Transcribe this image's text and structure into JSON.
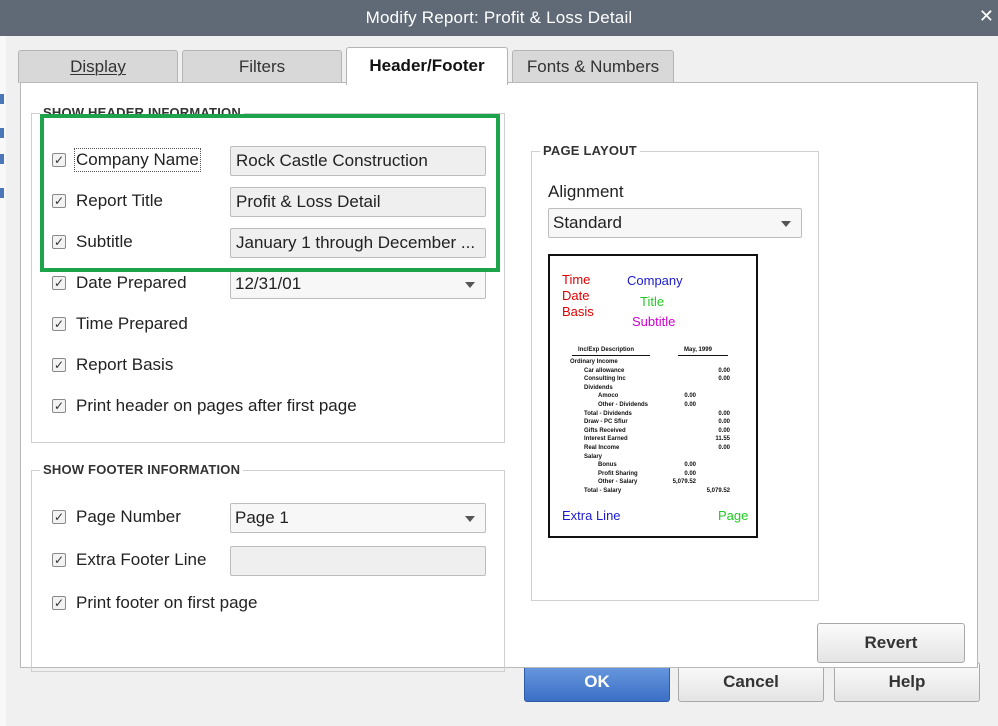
{
  "window": {
    "title": "Modify Report: Profit & Loss Detail",
    "close_glyph": "✕"
  },
  "tabs": [
    {
      "label": "Display",
      "active": false
    },
    {
      "label": "Filters",
      "active": false
    },
    {
      "label": "Header/Footer",
      "active": true
    },
    {
      "label": "Fonts & Numbers",
      "active": false
    }
  ],
  "header_section": {
    "label": "SHOW HEADER INFORMATION",
    "items": [
      {
        "label": "Company Name",
        "checked": true,
        "value": "Rock Castle Construction",
        "control": "text"
      },
      {
        "label": "Report Title",
        "checked": true,
        "value": "Profit & Loss Detail",
        "control": "text"
      },
      {
        "label": "Subtitle",
        "checked": true,
        "value": "January 1 through December ...",
        "control": "text"
      },
      {
        "label": "Date Prepared",
        "checked": true,
        "value": "12/31/01",
        "control": "combo"
      },
      {
        "label": "Time Prepared",
        "checked": true
      },
      {
        "label": "Report Basis",
        "checked": true
      },
      {
        "label": "Print header on pages after first page",
        "checked": true
      }
    ]
  },
  "footer_section": {
    "label": "SHOW FOOTER INFORMATION",
    "items": [
      {
        "label": "Page Number",
        "checked": true,
        "value": "Page 1",
        "control": "combo"
      },
      {
        "label": "Extra Footer Line",
        "checked": true,
        "value": "",
        "control": "text"
      },
      {
        "label": "Print footer on first page",
        "checked": true
      }
    ]
  },
  "page_layout": {
    "label": "PAGE LAYOUT",
    "alignment_label": "Alignment",
    "alignment_value": "Standard",
    "preview": {
      "left": [
        "Time",
        "Date",
        "Basis"
      ],
      "center": [
        "Company",
        "Title",
        "Subtitle"
      ],
      "footer_left": "Extra Line",
      "footer_right": "Page",
      "colors": {
        "left": "#e00000",
        "company": "#1a1ad0",
        "title": "#22cc22",
        "subtitle": "#d000d0",
        "extra": "#1a1ad0",
        "page": "#22cc22"
      },
      "col_headers": [
        "Inc/Exp Description",
        "May, 1999"
      ],
      "rows": [
        {
          "label": "Ordinary Income",
          "indent": 0,
          "mid": "",
          "right": ""
        },
        {
          "label": "Car allowance",
          "indent": 1,
          "mid": "",
          "right": "0.00"
        },
        {
          "label": "Consulting Inc",
          "indent": 1,
          "mid": "",
          "right": "0.00"
        },
        {
          "label": "Dividends",
          "indent": 1,
          "mid": "",
          "right": ""
        },
        {
          "label": "Amoco",
          "indent": 2,
          "mid": "0.00",
          "right": ""
        },
        {
          "label": "Other - Dividends",
          "indent": 2,
          "mid": "0.00",
          "right": ""
        },
        {
          "label": "Total - Dividends",
          "indent": 1,
          "mid": "",
          "right": "0.00"
        },
        {
          "label": "Draw - PC Sflur",
          "indent": 1,
          "mid": "",
          "right": "0.00"
        },
        {
          "label": "Gifts Received",
          "indent": 1,
          "mid": "",
          "right": "0.00"
        },
        {
          "label": "Interest Earned",
          "indent": 1,
          "mid": "",
          "right": "11.55"
        },
        {
          "label": "Real Income",
          "indent": 1,
          "mid": "",
          "right": "0.00"
        },
        {
          "label": "Salary",
          "indent": 1,
          "mid": "",
          "right": ""
        },
        {
          "label": "Bonus",
          "indent": 2,
          "mid": "0.00",
          "right": ""
        },
        {
          "label": "Profit Sharing",
          "indent": 2,
          "mid": "0.00",
          "right": ""
        },
        {
          "label": "Other - Salary",
          "indent": 2,
          "mid": "5,079.52",
          "right": ""
        },
        {
          "label": "Total - Salary",
          "indent": 1,
          "mid": "",
          "right": "5,079.52"
        }
      ]
    }
  },
  "buttons": {
    "revert": "Revert",
    "ok": "OK",
    "cancel": "Cancel",
    "help": "Help"
  }
}
